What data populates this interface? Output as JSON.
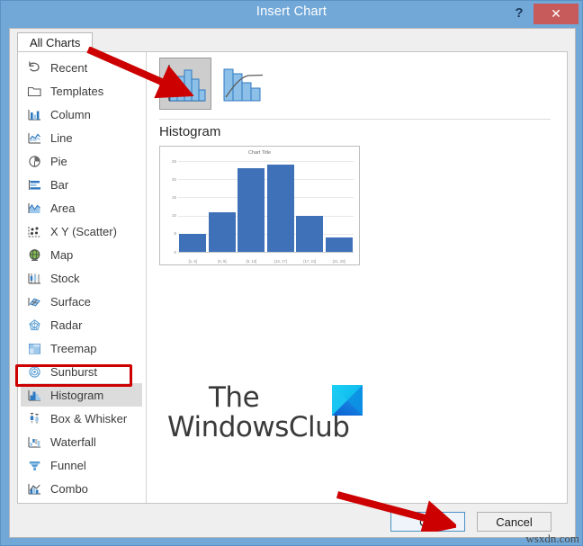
{
  "window": {
    "title": "Insert Chart",
    "help_label": "?",
    "close_label": "✕",
    "titlebar_color": "#72a8d8",
    "close_color": "#c75b5b"
  },
  "tabs": [
    {
      "label": "All Charts",
      "selected": true
    }
  ],
  "sidebar": {
    "items": [
      {
        "label": "Recent",
        "icon": "recent-clock-icon",
        "selected": false
      },
      {
        "label": "Templates",
        "icon": "folder-icon",
        "selected": false
      },
      {
        "label": "Column",
        "icon": "column-chart-icon",
        "selected": false
      },
      {
        "label": "Line",
        "icon": "line-chart-icon",
        "selected": false
      },
      {
        "label": "Pie",
        "icon": "pie-chart-icon",
        "selected": false
      },
      {
        "label": "Bar",
        "icon": "bar-chart-icon",
        "selected": false
      },
      {
        "label": "Area",
        "icon": "area-chart-icon",
        "selected": false
      },
      {
        "label": "X Y (Scatter)",
        "icon": "scatter-chart-icon",
        "selected": false
      },
      {
        "label": "Map",
        "icon": "map-globe-icon",
        "selected": false
      },
      {
        "label": "Stock",
        "icon": "stock-chart-icon",
        "selected": false
      },
      {
        "label": "Surface",
        "icon": "surface-chart-icon",
        "selected": false
      },
      {
        "label": "Radar",
        "icon": "radar-chart-icon",
        "selected": false
      },
      {
        "label": "Treemap",
        "icon": "treemap-icon",
        "selected": false
      },
      {
        "label": "Sunburst",
        "icon": "sunburst-icon",
        "selected": false
      },
      {
        "label": "Histogram",
        "icon": "histogram-icon",
        "selected": true
      },
      {
        "label": "Box & Whisker",
        "icon": "boxwhisker-icon",
        "selected": false
      },
      {
        "label": "Waterfall",
        "icon": "waterfall-icon",
        "selected": false
      },
      {
        "label": "Funnel",
        "icon": "funnel-icon",
        "selected": false
      },
      {
        "label": "Combo",
        "icon": "combo-chart-icon",
        "selected": false
      }
    ]
  },
  "preview": {
    "thumbnails": [
      {
        "name": "Histogram",
        "selected": true
      },
      {
        "name": "Pareto",
        "selected": false
      }
    ],
    "heading": "Histogram"
  },
  "chart_data": {
    "type": "bar",
    "title": "Chart Title",
    "categories": [
      "[1, 5]",
      "(5, 9]",
      "(9, 13]",
      "(13, 17]",
      "(17, 21]",
      "(21, 25]"
    ],
    "values": [
      5,
      11,
      23,
      24,
      10,
      4
    ],
    "xlabel": "",
    "ylabel": "",
    "ylim": [
      0,
      25
    ],
    "yticks": [
      0,
      5,
      10,
      15,
      20,
      25
    ],
    "grid": true,
    "legend": "none",
    "bar_color": "#3f71b9"
  },
  "buttons": {
    "ok": "OK",
    "cancel": "Cancel"
  },
  "watermark": {
    "line1": "The",
    "line2": "WindowsClub",
    "credit": "wsxdn.com"
  },
  "annotations": {
    "arrow_color": "#cc0000",
    "highlight_color": "#cc0000"
  }
}
